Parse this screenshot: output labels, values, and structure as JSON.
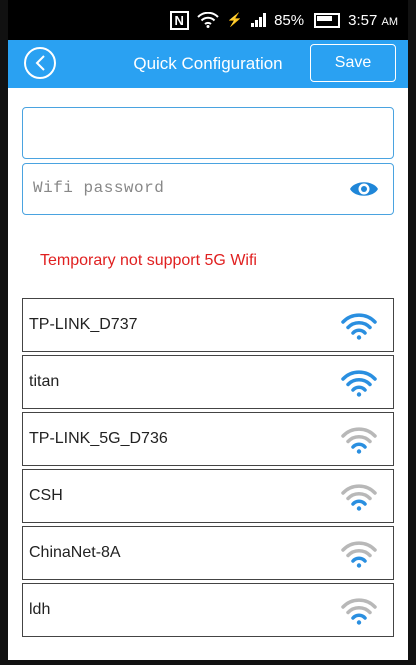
{
  "status_bar": {
    "nfc": "N",
    "battery_percent": "85%",
    "time": "3:57",
    "ampm": "AM"
  },
  "header": {
    "title": "Quick Configuration",
    "save_label": "Save"
  },
  "form": {
    "ssid_value": "",
    "password_placeholder": "Wifi password"
  },
  "warning": "Temporary not support 5G Wifi",
  "networks": [
    {
      "name": "TP-LINK_D737",
      "strong": true
    },
    {
      "name": "titan",
      "strong": true
    },
    {
      "name": "TP-LINK_5G_D736",
      "strong": false
    },
    {
      "name": "CSH",
      "strong": false
    },
    {
      "name": "ChinaNet-8A",
      "strong": false
    },
    {
      "name": "ldh",
      "strong": false
    }
  ],
  "colors": {
    "accent": "#2aa1f2",
    "wifi_strong": "#2a8fe0",
    "wifi_weak": "#b8b8b8",
    "warning": "#e02020"
  },
  "icons": {
    "back": "chevron-left-icon",
    "eye": "eye-icon",
    "wifi": "wifi-icon"
  }
}
